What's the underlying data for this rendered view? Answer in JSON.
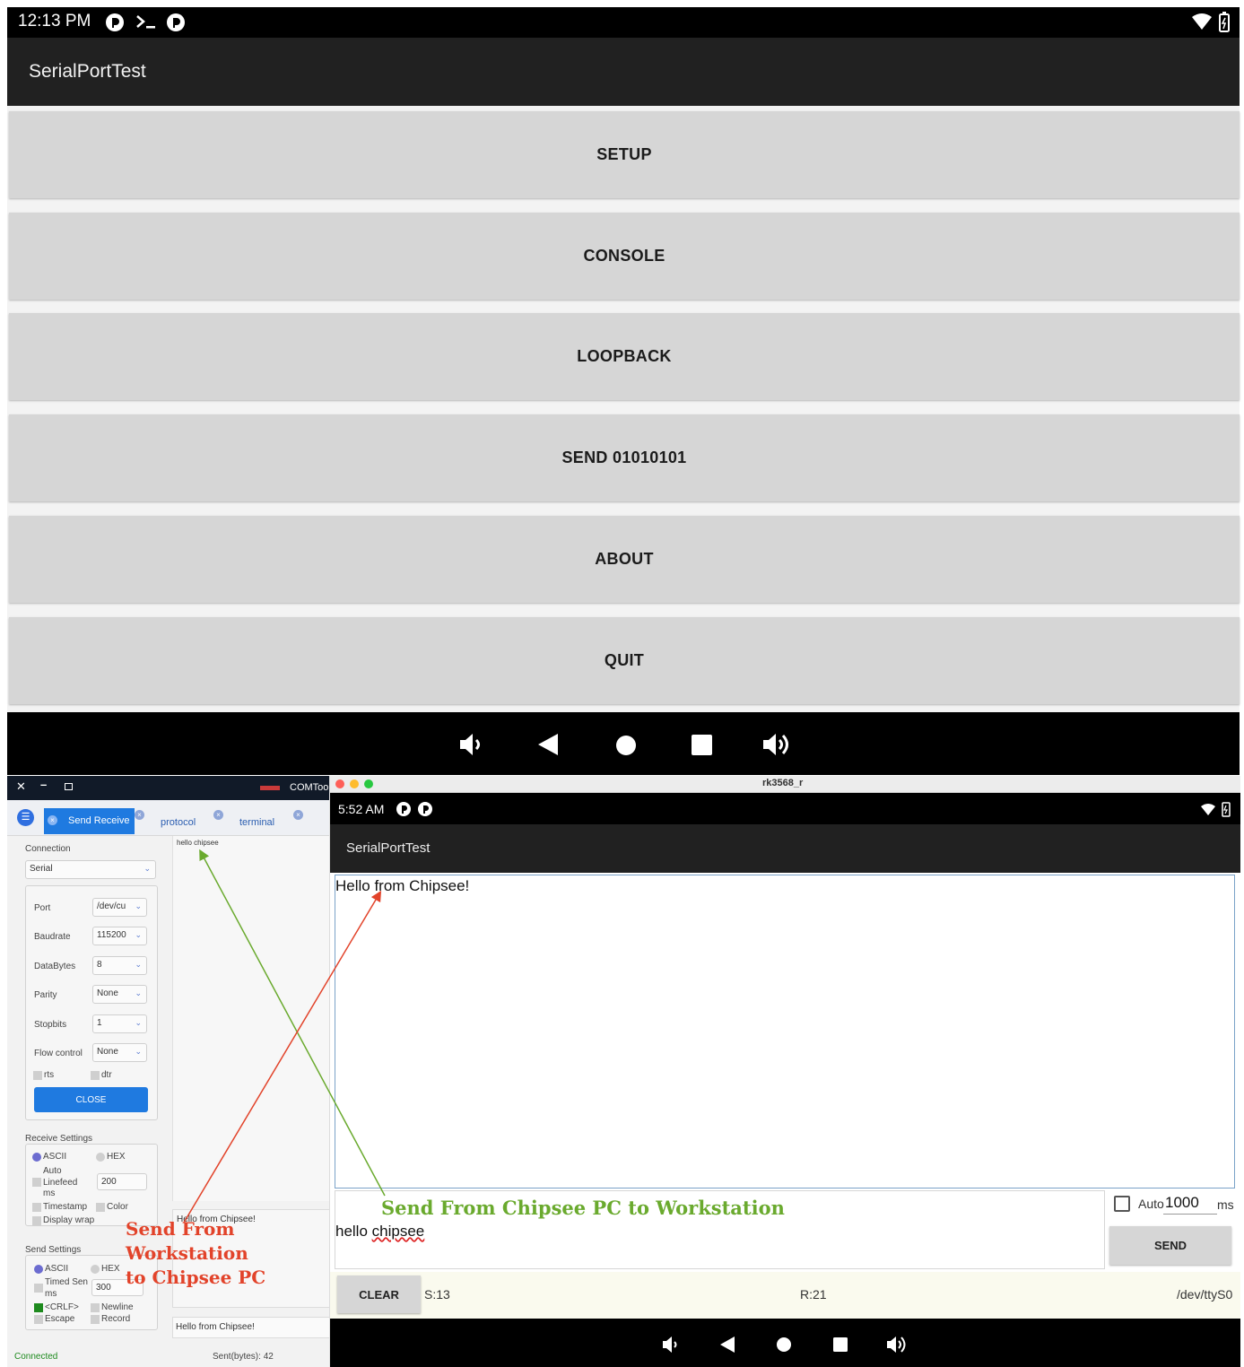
{
  "top_phone": {
    "status": {
      "time": "12:13 PM"
    },
    "app_title": "SerialPortTest",
    "menu": [
      "SETUP",
      "CONSOLE",
      "LOOPBACK",
      "SEND 01010101",
      "ABOUT",
      "QUIT"
    ]
  },
  "comtool": {
    "window_title": "COMTool",
    "tabs": [
      "Send Receive",
      "protocol",
      "terminal"
    ],
    "connection": {
      "header": "Connection",
      "type": "Serial",
      "port_label": "Port",
      "port_value": "/dev/cu",
      "baud_label": "Baudrate",
      "baud_value": "115200",
      "databytes_label": "DataBytes",
      "databytes_value": "8",
      "parity_label": "Parity",
      "parity_value": "None",
      "stopbits_label": "Stopbits",
      "stopbits_value": "1",
      "flow_label": "Flow control",
      "flow_value": "None",
      "rts_label": "rts",
      "dtr_label": "dtr",
      "close_label": "CLOSE"
    },
    "receive_settings": {
      "header": "Receive Settings",
      "ascii": "ASCII",
      "hex": "HEX",
      "auto_linefeed": "Auto Linefeed",
      "linefeed_ms": "200",
      "ms": "ms",
      "timestamp": "Timestamp",
      "color": "Color",
      "display_wrap": "Display wrap"
    },
    "send_settings": {
      "header": "Send Settings",
      "ascii": "ASCII",
      "hex": "HEX",
      "timed_send": "Timed Sen",
      "timed_ms": "300",
      "ms": "ms",
      "crlf": "<CRLF>",
      "newline": "Newline",
      "escape": "Escape",
      "record": "Record"
    },
    "receive_log": "hello chipsee",
    "send_history": "Hello from Chipsee!",
    "send_input": "Hello from Chipsee!",
    "status": {
      "connected": "Connected",
      "sent": "Sent(bytes): 42"
    }
  },
  "emulator": {
    "window_title": "rk3568_r",
    "status_time": "5:52 AM",
    "app_title": "SerialPortTest",
    "received_text": "Hello from Chipsee!",
    "send_text_prefix": "hello ",
    "send_text_word": "chipsee",
    "auto_label": "Auto",
    "auto_ms_value": "1000",
    "ms_label": "ms",
    "send_label": "SEND",
    "clear_label": "CLEAR",
    "sent_count": "S:13",
    "recv_count": "R:21",
    "device": "/dev/ttyS0"
  },
  "annotations": {
    "green": "Send From Chipsee PC to Workstation",
    "red_line1": "Send From",
    "red_line2": "Workstation",
    "red_line3": "to Chipsee PC",
    "green_color": "#6aaa2e",
    "red_color": "#e2432a"
  }
}
